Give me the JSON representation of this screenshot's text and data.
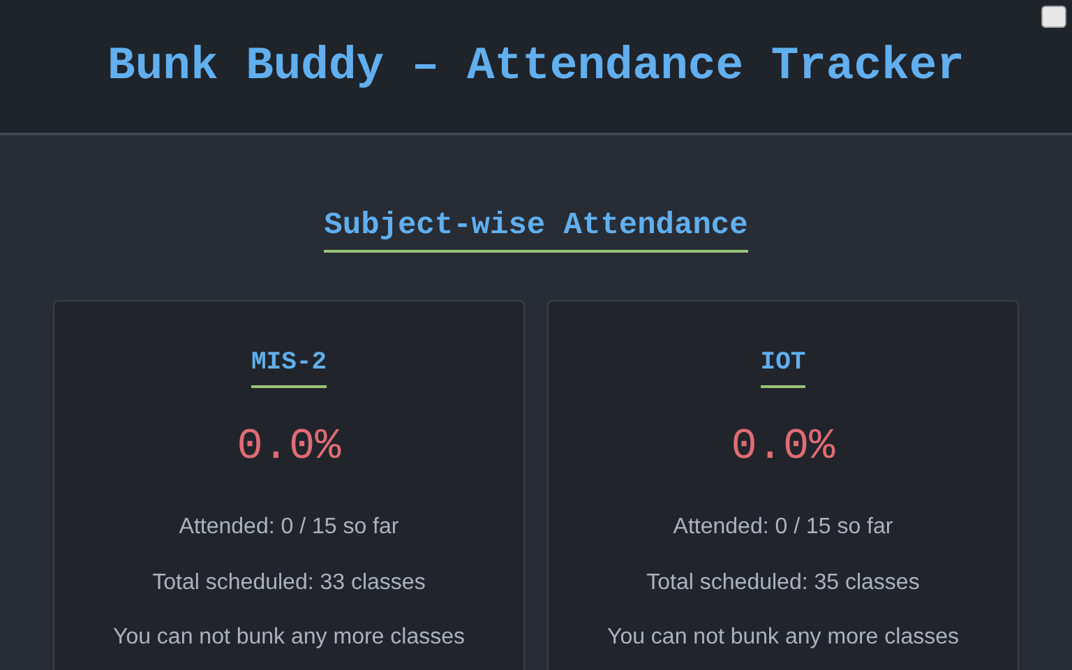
{
  "header": {
    "title": "Bunk Buddy – Attendance Tracker"
  },
  "section": {
    "title": "Subject-wise Attendance"
  },
  "subjects": [
    {
      "name": "MIS-2",
      "percentage": "0.0%",
      "attended": "Attended: 0 / 15 so far",
      "total": "Total scheduled: 33 classes",
      "bunk": "You can not bunk any more classes"
    },
    {
      "name": "IOT",
      "percentage": "0.0%",
      "attended": "Attended: 0 / 15 so far",
      "total": "Total scheduled: 35 classes",
      "bunk": "You can not bunk any more classes"
    }
  ]
}
